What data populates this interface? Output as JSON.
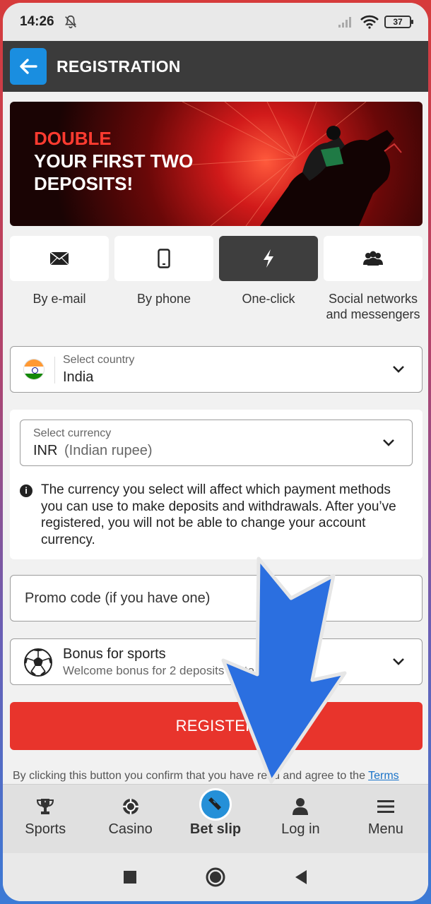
{
  "status_bar": {
    "time": "14:26",
    "battery": "37",
    "icons": [
      "bell-off-icon",
      "signal-icon",
      "wifi-icon",
      "battery-icon"
    ]
  },
  "header": {
    "title": "REGISTRATION",
    "back_icon": "arrow-left-icon"
  },
  "banner": {
    "line1": "DOUBLE",
    "line2": "YOUR FIRST TWO",
    "line3": "DEPOSITS!"
  },
  "tabs": [
    {
      "label": "By e-mail",
      "icon": "envelope-icon",
      "active": false
    },
    {
      "label": "By phone",
      "icon": "phone-icon",
      "active": false
    },
    {
      "label": "One-click",
      "icon": "lightning-icon",
      "active": true
    },
    {
      "label": "Social networks and messengers",
      "icon": "people-icon",
      "active": false
    }
  ],
  "country": {
    "label": "Select country",
    "value": "India"
  },
  "currency": {
    "label": "Select currency",
    "code": "INR",
    "name": "(Indian rupee)",
    "info": "The currency you select will affect which payment methods you can use to make deposits and withdrawals. After you’ve registered, you will not be able to change your account currency."
  },
  "promo": {
    "placeholder": "Promo code (if you have one)"
  },
  "bonus": {
    "title": "Bonus for sports",
    "subtitle": "Welcome bonus for 2 deposits up to 000 INR"
  },
  "register": {
    "label": "REGISTER"
  },
  "terms": {
    "text": "By clicking this button you confirm that you have read and agree to the ",
    "link": "Terms"
  },
  "bottom_nav": [
    {
      "label": "Sports",
      "icon": "trophy-icon"
    },
    {
      "label": "Casino",
      "icon": "casino-chip-icon"
    },
    {
      "label": "Bet slip",
      "icon": "ticket-icon"
    },
    {
      "label": "Log in",
      "icon": "user-icon"
    },
    {
      "label": "Menu",
      "icon": "menu-icon"
    }
  ],
  "colors": {
    "accent_red": "#e8342c",
    "accent_blue": "#1a8ee0",
    "header_bg": "#3b3b3b",
    "overlay_arrow": "#2b6fe0"
  }
}
